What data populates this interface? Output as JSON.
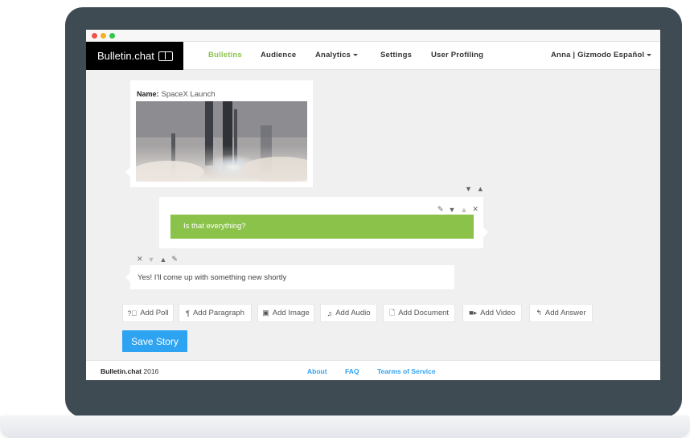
{
  "app": {
    "brand": "Bulletin.chat",
    "colors": {
      "accent_green": "#8bc34a",
      "accent_blue": "#2ea3f2",
      "brand_bg": "#000000"
    }
  },
  "nav": {
    "items": [
      {
        "label": "Bulletins",
        "active": true
      },
      {
        "label": "Audience"
      },
      {
        "label": "Analytics",
        "dropdown": true
      },
      {
        "label": "Settings"
      },
      {
        "label": "User Profiling"
      }
    ],
    "user": "Anna | Gizmodo Español"
  },
  "story": {
    "card1": {
      "name_label": "Name:",
      "name_value": "SpaceX Launch"
    },
    "card2": {
      "text": "Is that everything?"
    },
    "card3": {
      "text": "Yes! I'll come up with something new shortly"
    }
  },
  "toolbar": {
    "buttons": [
      {
        "label": "Add Poll",
        "icon": "question-circle-icon",
        "glyph": "❓"
      },
      {
        "label": "Add Paragraph",
        "icon": "paragraph-icon",
        "glyph": "¶"
      },
      {
        "label": "Add Image",
        "icon": "image-icon",
        "glyph": "🖼"
      },
      {
        "label": "Add Audio",
        "icon": "music-icon",
        "glyph": "♫"
      },
      {
        "label": "Add Document",
        "icon": "document-icon",
        "glyph": "🗋"
      },
      {
        "label": "Add Video",
        "icon": "video-camera-icon",
        "glyph": "🎥"
      },
      {
        "label": "Add Answer",
        "icon": "reply-icon",
        "glyph": "↰"
      }
    ],
    "save": "Save Story"
  },
  "footer": {
    "brand": "Bulletin.chat",
    "year": "2016",
    "links": [
      "About",
      "FAQ",
      "Tearms of Service"
    ]
  }
}
